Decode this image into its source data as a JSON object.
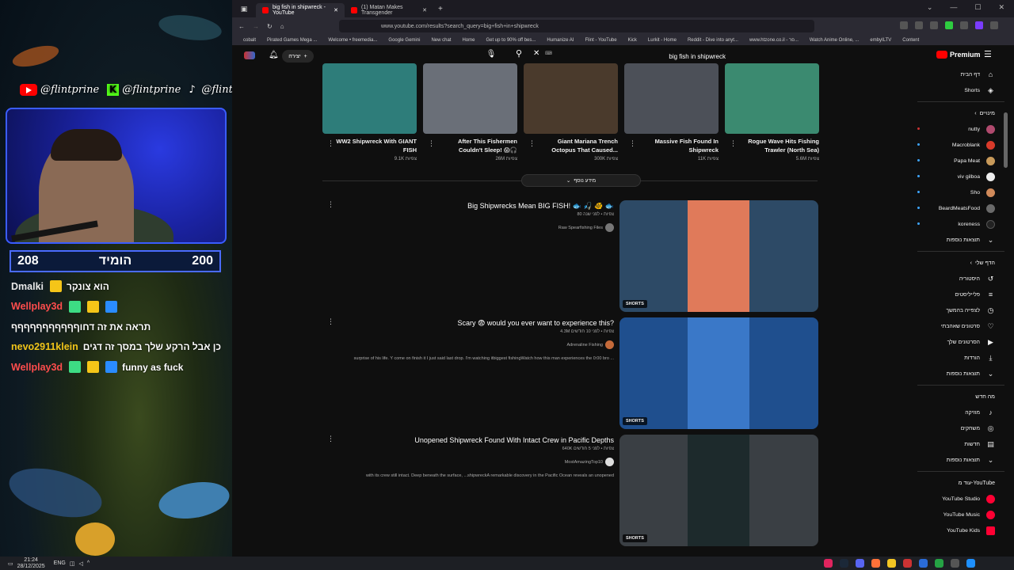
{
  "overlay": {
    "socials": [
      {
        "icon": "youtube-icon",
        "handle": "@flintprine"
      },
      {
        "icon": "kick-icon",
        "handle": "@flintprine"
      },
      {
        "icon": "tiktok-icon",
        "handle": "@flintprine"
      }
    ],
    "counter": {
      "left": "208",
      "label": "הומיד",
      "right": "200"
    },
    "chat": [
      {
        "user": "Dmalki",
        "color": "#e8e8e8",
        "text": "הוא צונקר"
      },
      {
        "user": "Wellplay3d",
        "color": "#ff4d4d",
        "text": ""
      },
      {
        "user": "",
        "color": "#ffffff",
        "text": "תראה את זה דחוףףףףףףףףףףף"
      },
      {
        "user": "nevo2911klein",
        "color": "#f0c419",
        "text": "כן אבל הרקע שלך במסך זה דגים"
      },
      {
        "user": "Wellplay3d",
        "color": "#ff4d4d",
        "text": "funny as fuck"
      }
    ]
  },
  "taskbar": {
    "time": "21:24",
    "date": "28/12/2025",
    "lang": "ENG"
  },
  "browser": {
    "tabs": [
      {
        "label": "big fish in shipwreck - YouTube",
        "active": true
      },
      {
        "label": "(1) Matan Makes Transgender",
        "active": false
      }
    ],
    "url": "www.youtube.com/results?search_query=big+fish+in+shipwreck",
    "bookmarks": [
      "cobalt",
      "Pirated Games Mega ...",
      "Welcome • freemedia...",
      "Google Gemini",
      "New chat",
      "Home",
      "Get up to 90% off bes...",
      "Humanize AI",
      "Flint - YouTube",
      "Kick",
      "Lurkit - Home",
      "Reddit - Dive into anyt...",
      "www.htzone.co.il - פר...",
      "Watch Anime Online, ...",
      "embyILTV",
      "Content"
    ]
  },
  "youtube": {
    "create_label": "יצירה",
    "search_query": "big fish in shipwreck",
    "search_kbd": "⌨",
    "logo_text": "Premium",
    "top_videos": [
      {
        "title": "WW2 Shipwreck With GIANT FISH",
        "views": "9.1K צפיות",
        "color": "#2e7d7a"
      },
      {
        "title": "After This Fishermen Couldn't Sleep! 😱🎧",
        "views": "26M צפיות",
        "color": "#6a6f78"
      },
      {
        "title": "Giant Mariana Trench Octopus That Caused...",
        "views": "300K צפיות",
        "color": "#4a3a2c"
      },
      {
        "title": "Massive Fish Found In Shipwreck",
        "views": "11K צפיות",
        "color": "#4c5058"
      },
      {
        "title": "Rogue Wave Hits Fishing Trawler (North Sea)",
        "views": "5.6M צפיות",
        "color": "#3b8a70"
      }
    ],
    "show_more": "מידע נוסף",
    "results": [
      {
        "title": "Big Shipwrecks Mean BIG FISH! 🐟 🎣 🐠 🐟",
        "meta": "80 צפיות • לפני שנה",
        "channel": "Raw Spearfishing Files",
        "desc": "",
        "shorts": "SHORTS",
        "thumb": "#2d4a66",
        "inner": "#e07a5a"
      },
      {
        "title": "Scary 😨 would you ever want to experience this?",
        "meta": "4.3M צפיות • לפני 10 חודשים",
        "channel": "Adrenaline Fishing",
        "desc": "surprise of his life. Y come on finish it I just said last drop. I'm watching itbiggest fishingWatch how this man experiences the 0:00 bro ...",
        "shorts": "SHORTS",
        "thumb": "#1f4f8e",
        "inner": "#3a78c8"
      },
      {
        "title": "Unopened Shipwreck Found With Intact Crew in Pacific Depths",
        "meta": "640K צפיות • לפני 5 חודשים",
        "channel": "MostAmazingTop10",
        "desc": "with its crew still intact. Deep beneath the surface, ...shipwreckA remarkable discovery in the Pacific Ocean reveals an unopened",
        "shorts": "SHORTS",
        "thumb": "#3a3f44",
        "inner": "#1d2a2c"
      }
    ],
    "guide": {
      "main": [
        {
          "label": "דף הבית",
          "icon": "home-icon",
          "glyph": "⌂"
        },
        {
          "label": "Shorts",
          "icon": "shorts-icon",
          "glyph": "◈"
        }
      ],
      "subs_title": "מינויים",
      "subs": [
        {
          "label": "nutty",
          "color": "#b04a6e"
        },
        {
          "label": "Macroblank",
          "color": "#d93a2a"
        },
        {
          "label": "Papa Meat",
          "color": "#c89a5a"
        },
        {
          "label": "viv gilboa",
          "color": "#eeeeee"
        },
        {
          "label": "Sho",
          "color": "#d08a5a"
        },
        {
          "label": "BeardMeatsFood",
          "color": "#6a6a6a"
        },
        {
          "label": "koreness",
          "color": "#222222"
        }
      ],
      "subs_more": "תוצאות נוספות",
      "you_title": "הדף שלי",
      "you": [
        {
          "label": "היסטוריה",
          "icon": "history-icon",
          "glyph": "↺"
        },
        {
          "label": "פלייליסטים",
          "icon": "playlist-icon",
          "glyph": "≡"
        },
        {
          "label": "לצפייה בהמשך",
          "icon": "watch-later-icon",
          "glyph": "◷"
        },
        {
          "label": "סרטונים שאהבתי",
          "icon": "like-icon",
          "glyph": "👍"
        },
        {
          "label": "הסרטונים שלך",
          "icon": "your-videos-icon",
          "glyph": "▶"
        },
        {
          "label": "הורדות",
          "icon": "download-icon",
          "glyph": "⤓"
        }
      ],
      "you_more": "תוצאות נוספות",
      "explore_title": "מה חדש",
      "explore": [
        {
          "label": "מוזיקה",
          "icon": "music-icon",
          "glyph": "♪"
        },
        {
          "label": "משחקים",
          "icon": "gaming-icon",
          "glyph": "◎"
        },
        {
          "label": "חדשות",
          "icon": "news-icon",
          "glyph": "▤"
        }
      ],
      "explore_more": "תוצאות נוספות",
      "more_title": "עוד מ-YouTube",
      "more": [
        {
          "label": "YouTube Studio",
          "color": "#ff0033"
        },
        {
          "label": "YouTube Music",
          "color": "#ff0033"
        },
        {
          "label": "YouTube Kids",
          "color": "#ff0033"
        }
      ]
    }
  }
}
